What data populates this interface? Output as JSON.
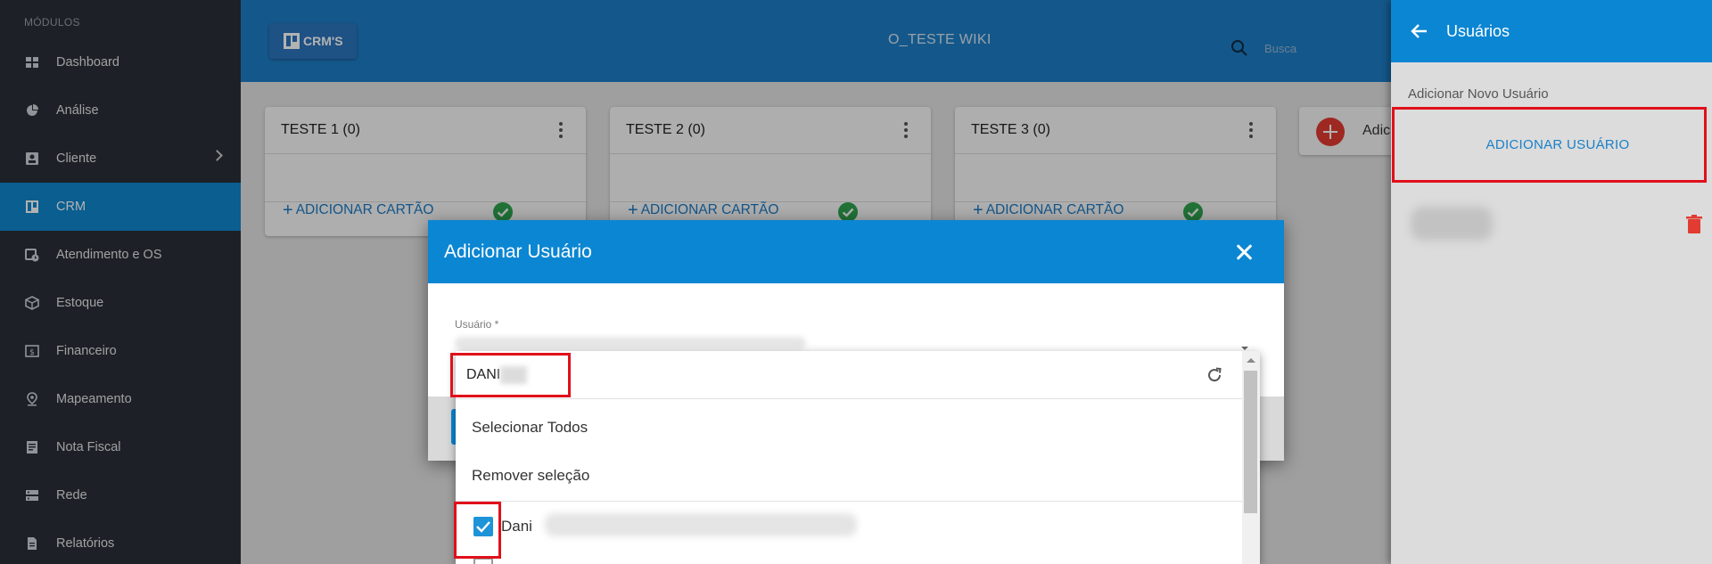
{
  "sidebar": {
    "header": "MÓDULOS",
    "items": [
      {
        "label": "Dashboard",
        "icon": "dashboard-icon"
      },
      {
        "label": "Análise",
        "icon": "pie-chart-icon"
      },
      {
        "label": "Cliente",
        "icon": "contact-card-icon"
      },
      {
        "label": "CRM",
        "icon": "board-icon",
        "active": true
      },
      {
        "label": "Atendimento e OS",
        "icon": "calendar-clock-icon"
      },
      {
        "label": "Estoque",
        "icon": "box-icon"
      },
      {
        "label": "Financeiro",
        "icon": "money-icon"
      },
      {
        "label": "Mapeamento",
        "icon": "map-pin-icon"
      },
      {
        "label": "Nota Fiscal",
        "icon": "receipt-icon"
      },
      {
        "label": "Rede",
        "icon": "server-icon"
      },
      {
        "label": "Relatórios",
        "icon": "document-icon"
      }
    ]
  },
  "topbar": {
    "crms_label": "CRM'S",
    "board_title": "O_TESTE WIKI",
    "search_placeholder": "Busca"
  },
  "columns": [
    {
      "title": "TESTE 1",
      "count": "(0)",
      "add_card": "ADICIONAR CARTÃO"
    },
    {
      "title": "TESTE 2",
      "count": "(0)",
      "add_card": "ADICIONAR CARTÃO"
    },
    {
      "title": "TESTE 3",
      "count": "(0)",
      "add_card": "ADICIONAR CARTÃO"
    }
  ],
  "add_list": {
    "label": "Adicionar"
  },
  "modal": {
    "title": "Adicionar Usuário",
    "field_label": "Usuário *",
    "dropdown": {
      "search_value": "DANI",
      "select_all": "Selecionar Todos",
      "remove_selection": "Remover seleção",
      "user_option": "Dani",
      "user_checked": true
    }
  },
  "right_panel": {
    "title": "Usuários",
    "subtitle": "Adicionar Novo Usuário",
    "add_button": "ADICIONAR USUÁRIO"
  },
  "colors": {
    "primary": "#0b86d2",
    "sidebar_bg": "#2a2f37",
    "highlight": "#e0101a",
    "success": "#2ea44f",
    "danger": "#e23b32"
  }
}
